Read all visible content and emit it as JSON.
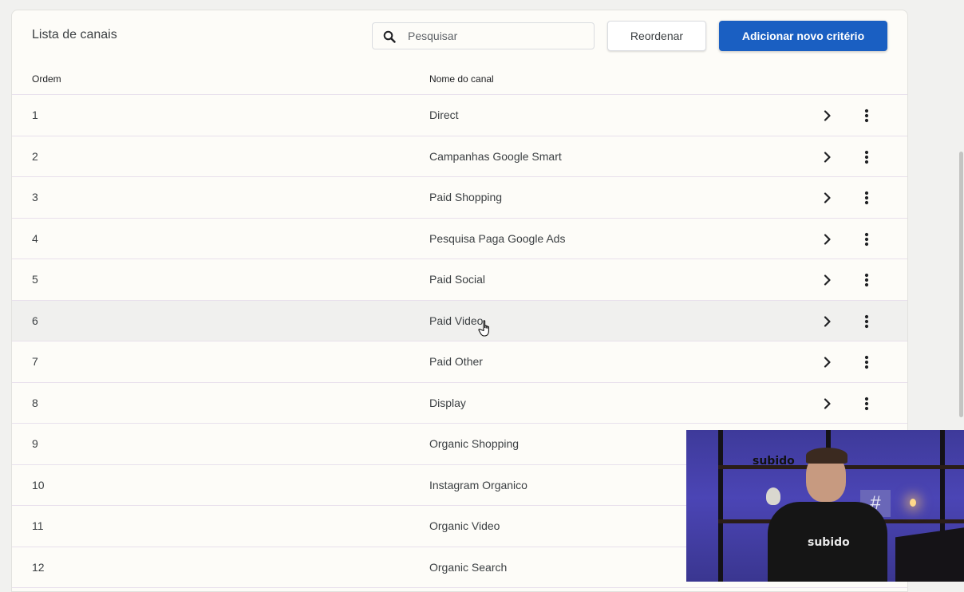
{
  "header": {
    "title": "Lista de canais",
    "search_placeholder": "Pesquisar",
    "reorder_label": "Reordenar",
    "add_label": "Adicionar novo critério"
  },
  "table": {
    "columns": {
      "order": "Ordem",
      "name": "Nome do canal"
    },
    "rows": [
      {
        "order": "1",
        "name": "Direct",
        "has_actions": true
      },
      {
        "order": "2",
        "name": "Campanhas Google Smart",
        "has_actions": true
      },
      {
        "order": "3",
        "name": "Paid Shopping",
        "has_actions": true
      },
      {
        "order": "4",
        "name": "Pesquisa Paga Google Ads",
        "has_actions": true
      },
      {
        "order": "5",
        "name": "Paid Social",
        "has_actions": true
      },
      {
        "order": "6",
        "name": "Paid Video",
        "has_actions": true,
        "hovered": true
      },
      {
        "order": "7",
        "name": "Paid Other",
        "has_actions": true
      },
      {
        "order": "8",
        "name": "Display",
        "has_actions": true
      },
      {
        "order": "9",
        "name": "Organic Shopping",
        "has_actions": false
      },
      {
        "order": "10",
        "name": "Instagram Organico",
        "has_actions": false
      },
      {
        "order": "11",
        "name": "Organic Video",
        "has_actions": false
      },
      {
        "order": "12",
        "name": "Organic Search",
        "has_actions": false
      }
    ]
  },
  "icons": {
    "search": "search-icon",
    "row_open": "chevron-right-icon",
    "row_menu": "more-vert-icon",
    "cursor": "hand-pointer-icon"
  },
  "video_overlay": {
    "wall_logo": "subido",
    "shirt_logo": "subido"
  },
  "colors": {
    "primary": "#1a5fc2",
    "card_bg": "#fdfcf8",
    "row_divider": "#e8e0ec",
    "hover_row": "#f0f0ee"
  }
}
